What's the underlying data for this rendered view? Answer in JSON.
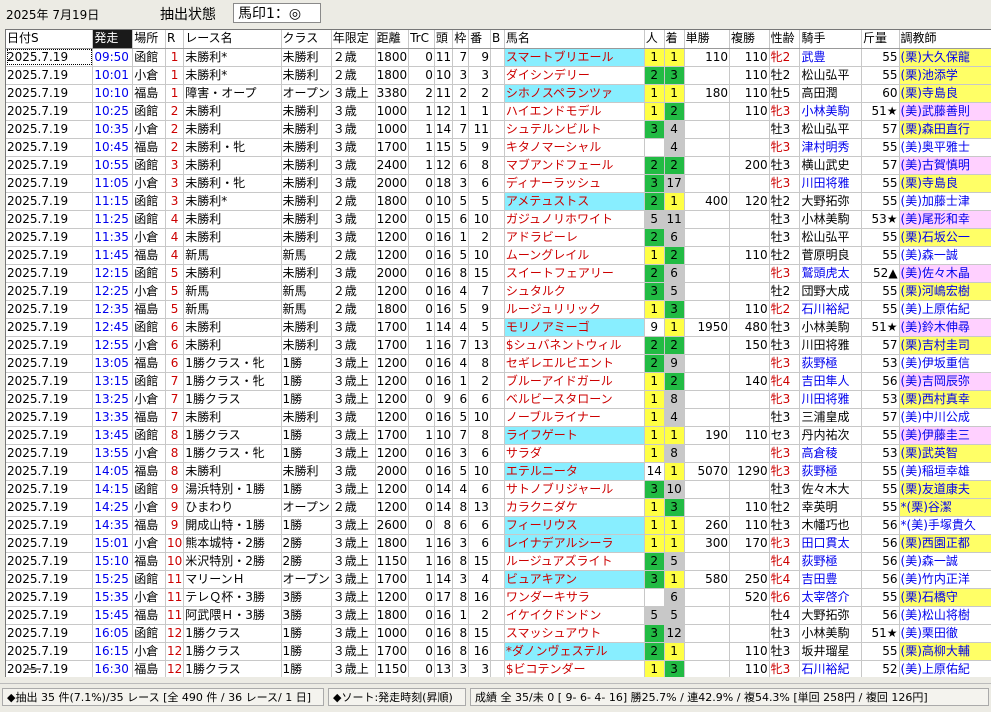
{
  "header": {
    "date": "2025年  7月19日",
    "filter_label": "抽出状態",
    "filter_value": "馬印1：◎"
  },
  "columns": [
    "日付S",
    "発走",
    "場所",
    "R",
    "レース名",
    "クラス",
    "年限定",
    "距離",
    "TrC",
    "頭",
    "枠",
    "番",
    "B",
    "馬名",
    "人",
    "着",
    "単勝",
    "複勝",
    "性齢",
    "騎手",
    "斤量",
    "調教師"
  ],
  "rows": [
    [
      "2025.7.19",
      "09:50",
      "函館",
      "1",
      "未勝利*",
      "未勝利",
      "２歳",
      "1800",
      "0",
      "11",
      "7",
      "9",
      "",
      "スマートブリエール",
      "1",
      "1",
      "110",
      "110",
      "牝2",
      "武豊",
      "55",
      "(栗)大久保龍"
    ],
    [
      "2025.7.19",
      "10:01",
      "小倉",
      "1",
      "未勝利*",
      "未勝利",
      "２歳",
      "1800",
      "0",
      "10",
      "3",
      "3",
      "",
      "ダイシンデリー",
      "2",
      "3",
      "",
      "110",
      "牡2",
      "松山弘平",
      "55",
      "(栗)池添学"
    ],
    [
      "2025.7.19",
      "10:10",
      "福島",
      "1",
      "障害・オープ",
      "オープン",
      "３歳上",
      "3380",
      "2",
      "11",
      "2",
      "2",
      "",
      "シホノスペランツァ",
      "1",
      "1",
      "180",
      "110",
      "牡5",
      "高田潤",
      "60",
      "(栗)寺島良"
    ],
    [
      "2025.7.19",
      "10:25",
      "函館",
      "2",
      "未勝利",
      "未勝利",
      "３歳",
      "1000",
      "1",
      "12",
      "1",
      "1",
      "",
      "ハイエンドモデル",
      "1",
      "2",
      "",
      "110",
      "牝3",
      "小林美駒",
      "51★",
      "(美)武藤善則"
    ],
    [
      "2025.7.19",
      "10:35",
      "小倉",
      "2",
      "未勝利",
      "未勝利",
      "３歳",
      "1000",
      "1",
      "14",
      "7",
      "11",
      "",
      "シュテルンビルト",
      "3",
      "4",
      "",
      "",
      "牡3",
      "松山弘平",
      "57",
      "(栗)森田直行"
    ],
    [
      "2025.7.19",
      "10:45",
      "福島",
      "2",
      "未勝利・牝",
      "未勝利",
      "３歳",
      "1700",
      "1",
      "15",
      "5",
      "9",
      "",
      "キタノマーシャル",
      "",
      "4",
      "",
      "",
      "牝3",
      "津村明秀",
      "55",
      "(美)奥平雅士"
    ],
    [
      "2025.7.19",
      "10:55",
      "函館",
      "3",
      "未勝利",
      "未勝利",
      "３歳",
      "2400",
      "1",
      "12",
      "6",
      "8",
      "",
      "マブアンドフェール",
      "2",
      "2",
      "",
      "200",
      "牡3",
      "横山武史",
      "57",
      "(美)古賀慎明"
    ],
    [
      "2025.7.19",
      "11:05",
      "小倉",
      "3",
      "未勝利・牝",
      "未勝利",
      "３歳",
      "2000",
      "0",
      "18",
      "3",
      "6",
      "",
      "ディナーラッシュ",
      "3",
      "17",
      "",
      "",
      "牝3",
      "川田将雅",
      "55",
      "(栗)寺島良"
    ],
    [
      "2025.7.19",
      "11:15",
      "函館",
      "3",
      "未勝利*",
      "未勝利",
      "２歳",
      "1800",
      "0",
      "10",
      "5",
      "5",
      "",
      "アメテュストス",
      "2",
      "1",
      "400",
      "120",
      "牡2",
      "大野拓弥",
      "55",
      "(美)加藤士津"
    ],
    [
      "2025.7.19",
      "11:25",
      "函館",
      "4",
      "未勝利",
      "未勝利",
      "３歳",
      "1200",
      "0",
      "15",
      "6",
      "10",
      "",
      "ガジュノリホワイト",
      "5",
      "11",
      "",
      "",
      "牡3",
      "小林美駒",
      "53★",
      "(美)尾形和幸"
    ],
    [
      "2025.7.19",
      "11:35",
      "小倉",
      "4",
      "未勝利",
      "未勝利",
      "３歳",
      "1200",
      "0",
      "16",
      "1",
      "2",
      "",
      "アドラビーレ",
      "2",
      "6",
      "",
      "",
      "牡3",
      "松山弘平",
      "55",
      "(栗)石坂公一"
    ],
    [
      "2025.7.19",
      "11:45",
      "福島",
      "4",
      "新馬",
      "新馬",
      "２歳",
      "1200",
      "0",
      "16",
      "5",
      "10",
      "",
      "ムーングレイル",
      "1",
      "2",
      "",
      "110",
      "牡2",
      "菅原明良",
      "55",
      "(美)森一誠"
    ],
    [
      "2025.7.19",
      "12:15",
      "函館",
      "5",
      "未勝利",
      "未勝利",
      "３歳",
      "2000",
      "0",
      "16",
      "8",
      "15",
      "",
      "スイートフェアリー",
      "2",
      "6",
      "",
      "",
      "牝3",
      "鷲頭虎太",
      "52▲",
      "(美)佐々木晶"
    ],
    [
      "2025.7.19",
      "12:25",
      "小倉",
      "5",
      "新馬",
      "新馬",
      "２歳",
      "1200",
      "0",
      "16",
      "4",
      "7",
      "",
      "シュタルク",
      "3",
      "5",
      "",
      "",
      "牡2",
      "団野大成",
      "55",
      "(栗)河嶋宏樹"
    ],
    [
      "2025.7.19",
      "12:35",
      "福島",
      "5",
      "新馬",
      "新馬",
      "２歳",
      "1800",
      "0",
      "16",
      "5",
      "9",
      "",
      "ルージュリリック",
      "1",
      "3",
      "",
      "110",
      "牝2",
      "石川裕紀",
      "55",
      "(美)上原佑紀"
    ],
    [
      "2025.7.19",
      "12:45",
      "函館",
      "6",
      "未勝利",
      "未勝利",
      "３歳",
      "1700",
      "1",
      "14",
      "4",
      "5",
      "",
      "モリノアミーゴ",
      "9",
      "1",
      "1950",
      "480",
      "牡3",
      "小林美駒",
      "51★",
      "(美)鈴木伸尋"
    ],
    [
      "2025.7.19",
      "12:55",
      "小倉",
      "6",
      "未勝利",
      "未勝利",
      "３歳",
      "1700",
      "1",
      "16",
      "7",
      "13",
      "",
      "$シュバネントウィル",
      "2",
      "2",
      "",
      "150",
      "牡3",
      "川田将雅",
      "57",
      "(栗)吉村圭司"
    ],
    [
      "2025.7.19",
      "13:05",
      "福島",
      "6",
      "1勝クラス・牝",
      "1勝",
      "３歳上",
      "1200",
      "0",
      "16",
      "4",
      "8",
      "",
      "セギレエルビエント",
      "2",
      "9",
      "",
      "",
      "牝3",
      "荻野極",
      "53",
      "(美)伊坂重信"
    ],
    [
      "2025.7.19",
      "13:15",
      "函館",
      "7",
      "1勝クラス・牝",
      "1勝",
      "３歳上",
      "1200",
      "0",
      "16",
      "1",
      "2",
      "",
      "ブルーアイドガール",
      "1",
      "2",
      "",
      "140",
      "牝4",
      "吉田隼人",
      "56",
      "(美)吉岡辰弥"
    ],
    [
      "2025.7.19",
      "13:25",
      "小倉",
      "7",
      "1勝クラス",
      "1勝",
      "３歳上",
      "1200",
      "0",
      "9",
      "6",
      "6",
      "",
      "ベルビースタローン",
      "1",
      "8",
      "",
      "",
      "牝3",
      "川田将雅",
      "53",
      "(栗)西村真幸"
    ],
    [
      "2025.7.19",
      "13:35",
      "福島",
      "7",
      "未勝利",
      "未勝利",
      "３歳",
      "1200",
      "0",
      "16",
      "5",
      "10",
      "",
      "ノーブルライナー",
      "1",
      "4",
      "",
      "",
      "牡3",
      "三浦皇成",
      "57",
      "(美)中川公成"
    ],
    [
      "2025.7.19",
      "13:45",
      "函館",
      "8",
      "1勝クラス",
      "1勝",
      "３歳上",
      "1700",
      "1",
      "10",
      "7",
      "8",
      "",
      "ライフゲート",
      "1",
      "1",
      "190",
      "110",
      "セ3",
      "丹内祐次",
      "55",
      "(美)伊藤圭三"
    ],
    [
      "2025.7.19",
      "13:55",
      "小倉",
      "8",
      "1勝クラス・牝",
      "1勝",
      "３歳上",
      "1200",
      "0",
      "16",
      "3",
      "6",
      "",
      "サラダ",
      "1",
      "8",
      "",
      "",
      "牝3",
      "高倉稜",
      "53",
      "(栗)武英智"
    ],
    [
      "2025.7.19",
      "14:05",
      "福島",
      "8",
      "未勝利",
      "未勝利",
      "３歳",
      "2000",
      "0",
      "16",
      "5",
      "10",
      "",
      "エテルニータ",
      "14",
      "1",
      "5070",
      "1290",
      "牝3",
      "荻野極",
      "55",
      "(美)稲垣幸雄"
    ],
    [
      "2025.7.19",
      "14:15",
      "函館",
      "9",
      "湯浜特別・1勝",
      "1勝",
      "３歳上",
      "1200",
      "0",
      "14",
      "4",
      "6",
      "",
      "サトノブリジャール",
      "3",
      "10",
      "",
      "",
      "牡3",
      "佐々木大",
      "55",
      "(栗)友道康夫"
    ],
    [
      "2025.7.19",
      "14:25",
      "小倉",
      "9",
      "ひまわり",
      "オープン",
      "２歳",
      "1200",
      "0",
      "14",
      "8",
      "13",
      "",
      "カラクニダケ",
      "1",
      "3",
      "",
      "110",
      "牡2",
      "幸英明",
      "55",
      "*(栗)谷潔"
    ],
    [
      "2025.7.19",
      "14:35",
      "福島",
      "9",
      "開成山特・1勝",
      "1勝",
      "３歳上",
      "2600",
      "0",
      "8",
      "6",
      "6",
      "",
      "フィーリウス",
      "1",
      "1",
      "260",
      "110",
      "牡3",
      "木幡巧也",
      "56",
      "*(美)手塚貴久"
    ],
    [
      "2025.7.19",
      "15:01",
      "小倉",
      "10",
      "熊本城特・2勝",
      "2勝",
      "３歳上",
      "1800",
      "1",
      "16",
      "3",
      "6",
      "",
      "レイナデアルシーラ",
      "1",
      "1",
      "300",
      "170",
      "牝3",
      "田口貫太",
      "56",
      "(栗)西園正都"
    ],
    [
      "2025.7.19",
      "15:10",
      "福島",
      "10",
      "米沢特別・2勝",
      "2勝",
      "３歳上",
      "1150",
      "1",
      "16",
      "8",
      "15",
      "",
      "ルージュアズライト",
      "2",
      "5",
      "",
      "",
      "牝4",
      "荻野極",
      "56",
      "(美)森一誠"
    ],
    [
      "2025.7.19",
      "15:25",
      "函館",
      "11",
      "マリーンＨ",
      "オープン",
      "３歳上",
      "1700",
      "1",
      "14",
      "3",
      "4",
      "",
      "ビュアキアン",
      "3",
      "1",
      "580",
      "250",
      "牝4",
      "吉田豊",
      "56",
      "(美)竹内正洋"
    ],
    [
      "2025.7.19",
      "15:35",
      "小倉",
      "11",
      "テレＱ杯・3勝",
      "3勝",
      "３歳上",
      "1200",
      "0",
      "17",
      "8",
      "16",
      "",
      "ワンダーキサラ",
      "",
      "6",
      "",
      "520",
      "牝6",
      "太宰啓介",
      "55",
      "(栗)石橋守"
    ],
    [
      "2025.7.19",
      "15:45",
      "福島",
      "11",
      "阿武隈Ｈ・3勝",
      "3勝",
      "３歳上",
      "1800",
      "0",
      "16",
      "1",
      "2",
      "",
      "イケイクドンドン",
      "5",
      "5",
      "",
      "",
      "牡4",
      "大野拓弥",
      "56",
      "(美)松山将樹"
    ],
    [
      "2025.7.19",
      "16:05",
      "函館",
      "12",
      "1勝クラス",
      "1勝",
      "３歳上",
      "1000",
      "0",
      "16",
      "8",
      "15",
      "",
      "スマッシュアウト",
      "3",
      "12",
      "",
      "",
      "牡3",
      "小林美駒",
      "51★",
      "(美)栗田徹"
    ],
    [
      "2025.7.19",
      "16:15",
      "小倉",
      "12",
      "1勝クラス",
      "1勝",
      "３歳上",
      "1700",
      "0",
      "16",
      "8",
      "16",
      "",
      "*ダノンヴェステル",
      "2",
      "1",
      "",
      "110",
      "牡3",
      "坂井瑠星",
      "55",
      "(栗)高柳大輔"
    ],
    [
      "2025.7.19",
      "16:30",
      "福島",
      "12",
      "1勝クラス",
      "1勝",
      "３歳上",
      "1150",
      "0",
      "13",
      "3",
      "3",
      "",
      "$ビコテンダー",
      "1",
      "3",
      "",
      "110",
      "牝3",
      "石川裕紀",
      "52",
      "(美)上原佑紀"
    ]
  ],
  "status": {
    "extract": "◆抽出 35 件(7.1%)/35 レース [全 490 件 / 36 レース/ 1 日]",
    "sort": "◆ソート:発走時刻(昇順)",
    "result": "成績 全 35/未 0 [ 9- 6- 4- 16] 勝25.7% / 連42.9% / 複54.3% [単回 258円 / 複回 126円]"
  },
  "colors": {
    "yellow": "#ffff44",
    "green": "#22bb44",
    "gray": "#c8c8c8",
    "cyan": "#88eeff",
    "blue_text": "#0000ee",
    "red_text": "#cc0000"
  }
}
